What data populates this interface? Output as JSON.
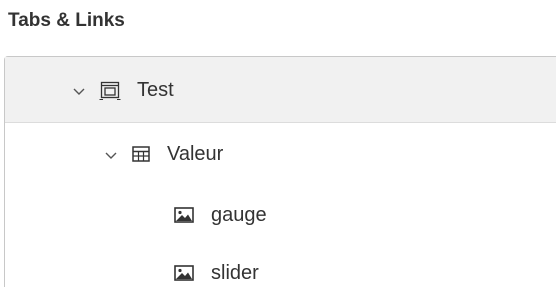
{
  "panel": {
    "title": "Tabs & Links"
  },
  "tree": {
    "items": [
      {
        "label": "Test",
        "icon": "tab-container-icon",
        "expanded": true,
        "selected": true,
        "level": 1
      },
      {
        "label": "Valeur",
        "icon": "table-grid-icon",
        "expanded": true,
        "selected": false,
        "level": 2
      },
      {
        "label": "gauge",
        "icon": "image-icon",
        "selected": false,
        "level": 3
      },
      {
        "label": "slider",
        "icon": "image-icon",
        "selected": false,
        "level": 3
      }
    ]
  },
  "colors": {
    "selected_background": "#f1f1f1",
    "text": "#333333",
    "border": "#c8c8c8"
  }
}
